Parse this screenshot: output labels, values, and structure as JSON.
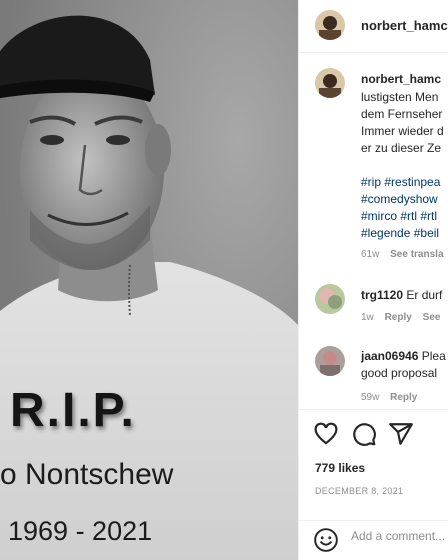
{
  "post": {
    "overlay": {
      "rip": "R.I.P.",
      "name": "o Nontschew",
      "years": "1969 - 2021"
    }
  },
  "header": {
    "username": "norbert_hamc"
  },
  "caption": {
    "username": "norbert_hamc",
    "lines": [
      "lustigsten Men",
      "dem Fernseher",
      "Immer wieder d",
      "er zu dieser Ze"
    ],
    "hashtags": [
      "#rip #restinpea",
      "#comedyshow",
      "#mirco #rtl #rtl",
      "#legende #beil"
    ],
    "age": "61w",
    "see_translation": "See transla"
  },
  "comments": [
    {
      "username": "trg1120",
      "text": " Er durf",
      "age": "1w",
      "reply": "Reply",
      "see": "See"
    },
    {
      "username": "jaan06946",
      "text": " Plea",
      "text2": "good proposal",
      "age": "59w",
      "reply": "Reply"
    }
  ],
  "actions": {
    "icons": [
      "heart-icon",
      "comment-icon",
      "share-icon"
    ]
  },
  "likes": "779 likes",
  "date": "DECEMBER 8, 2021",
  "add_comment": {
    "placeholder": "Add a comment..."
  }
}
